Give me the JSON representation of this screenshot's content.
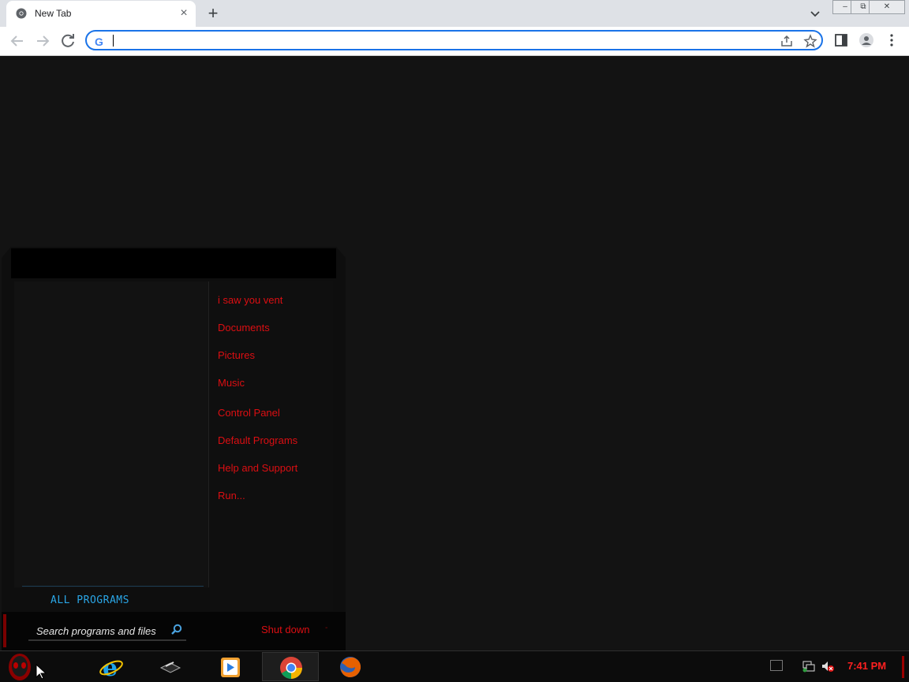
{
  "browser": {
    "tab_title": "New Tab",
    "tab_close": "×",
    "new_tab": "+",
    "window_controls": {
      "minimize": "‒",
      "restore": "⧉",
      "close": "✕"
    },
    "omnibox_value": "",
    "icons": [
      "chrome-icon",
      "back-icon",
      "forward-icon",
      "reload-icon",
      "google-icon",
      "share-icon",
      "star-icon",
      "side-panel-icon",
      "profile-icon",
      "menu-icon",
      "tab-search-icon"
    ]
  },
  "start_menu": {
    "right_items": [
      "i saw you vent",
      "Documents",
      "Pictures",
      "Music",
      "Control Panel",
      "Default Programs",
      "Help and Support",
      "Run..."
    ],
    "all_programs": "ALL PROGRAMS",
    "search_placeholder": "Search programs and files",
    "shutdown": "Shut down",
    "shutdown_arrow": "-"
  },
  "taskbar": {
    "apps": [
      "start-orb",
      "internet-explorer",
      "media-center",
      "windows-media-player",
      "google-chrome",
      "firefox"
    ],
    "active_app": "google-chrome",
    "clock": "7:41 PM",
    "tray_icons": [
      "action-center-icon",
      "network-icon",
      "volume-muted-icon"
    ]
  },
  "colors": {
    "accent_red": "#dc0e12",
    "accent_blue": "#2aa6e6",
    "background": "#131313"
  }
}
